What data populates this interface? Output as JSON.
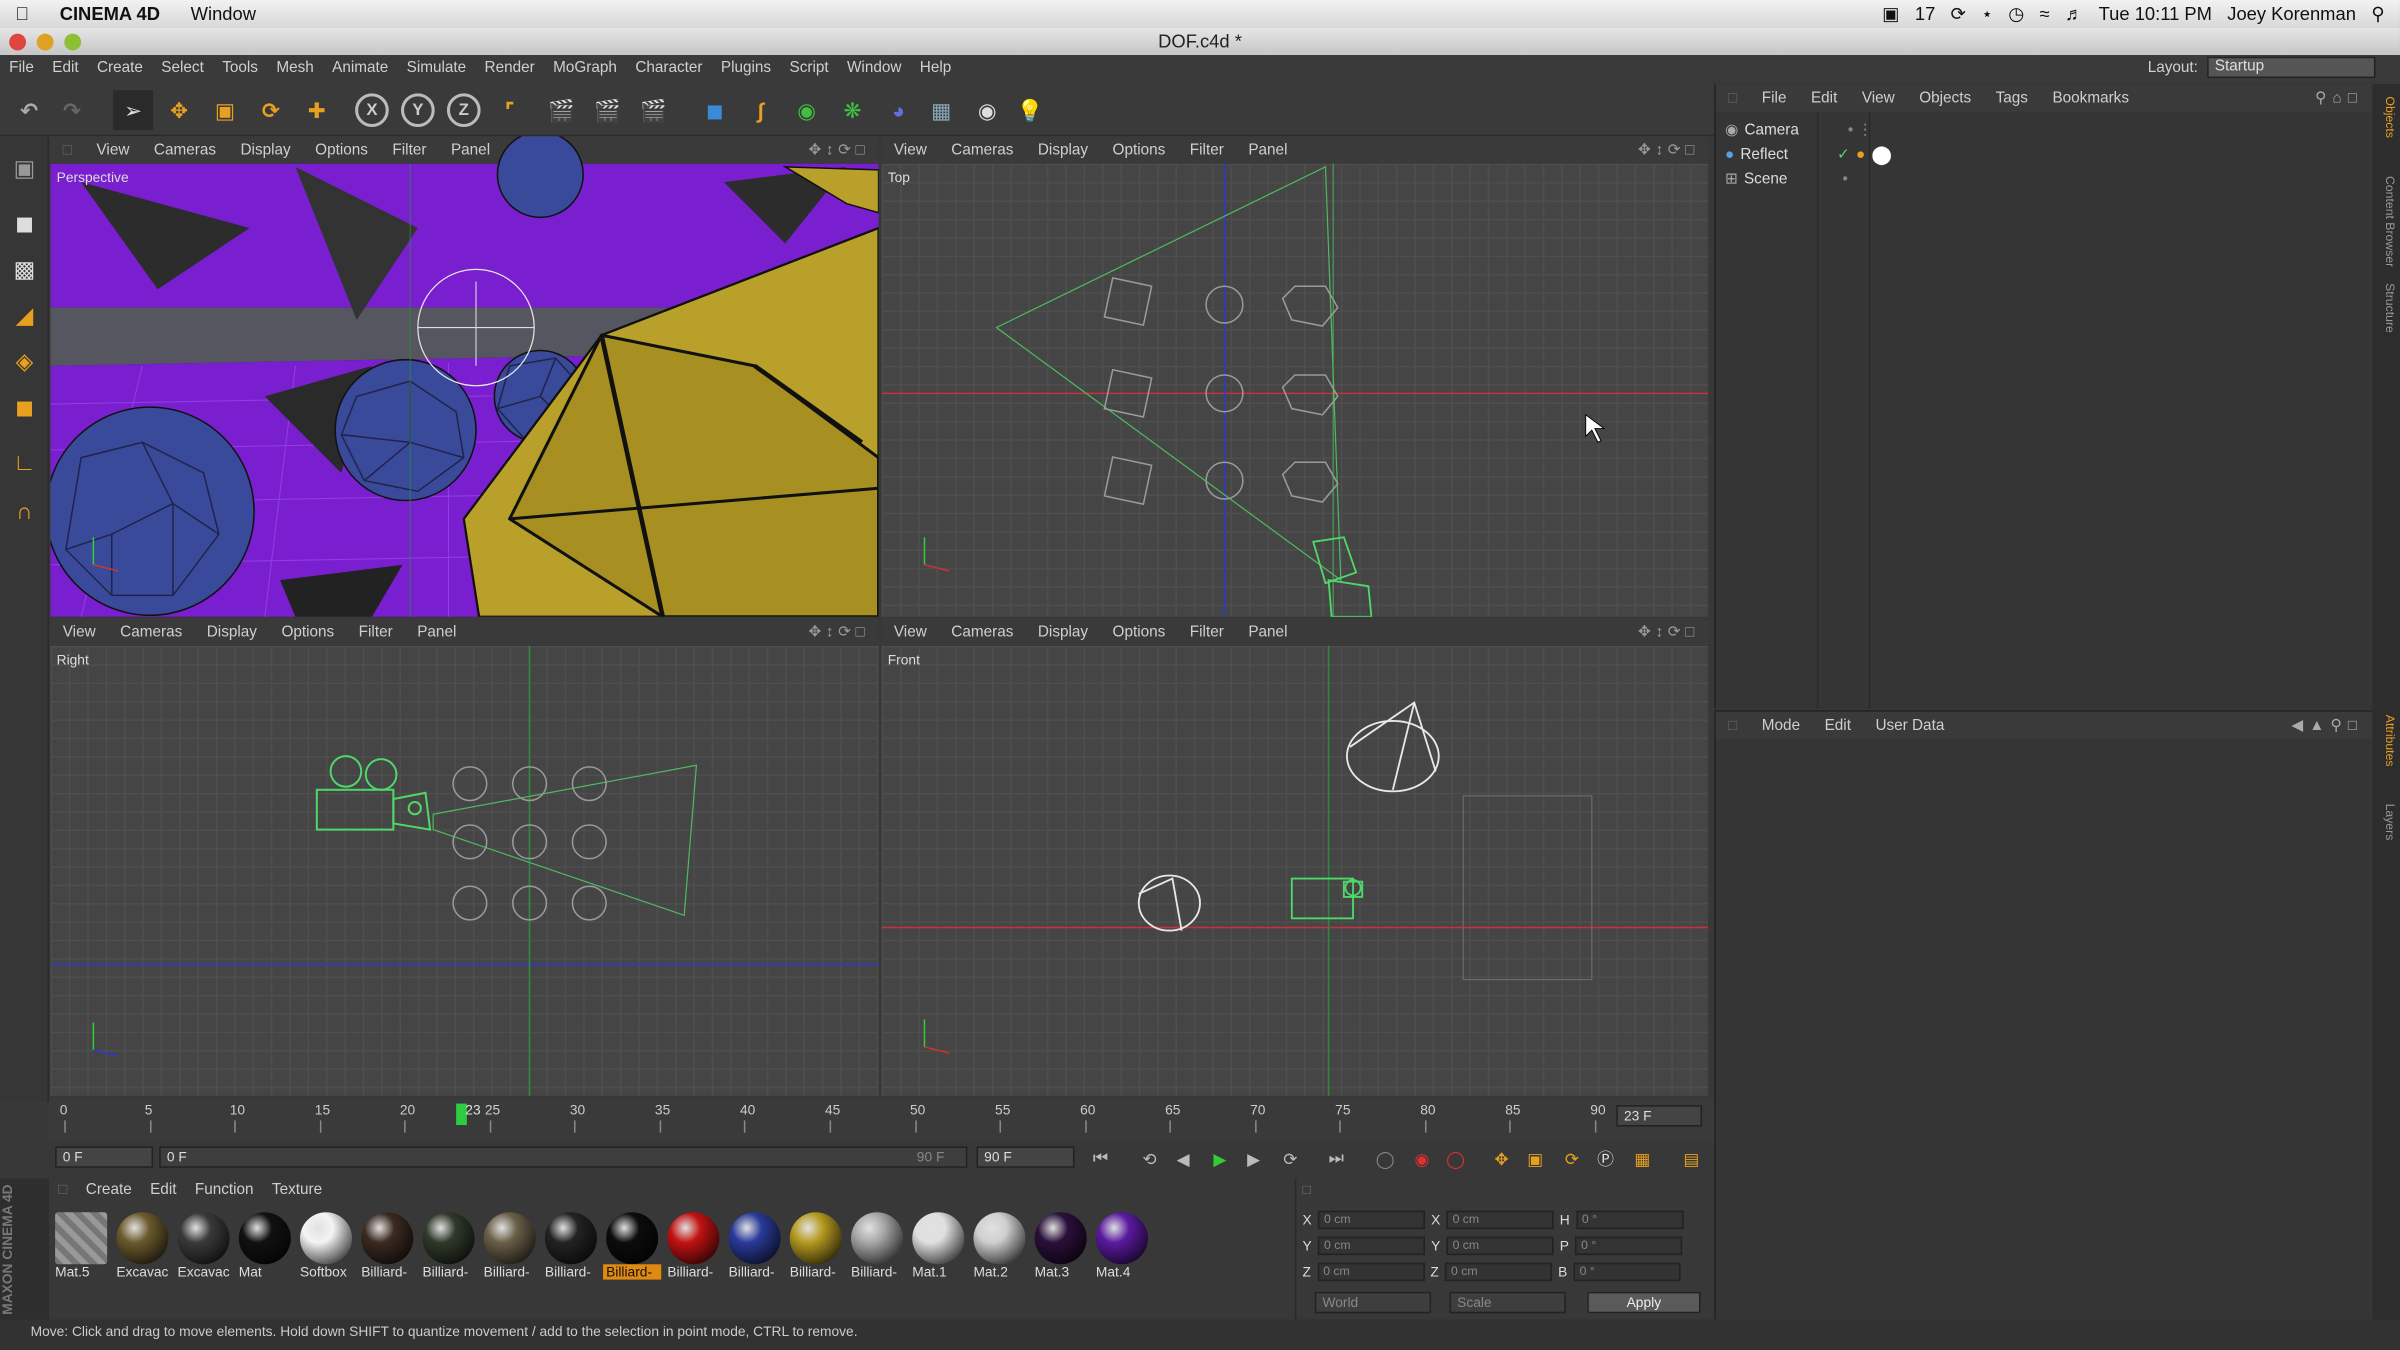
{
  "mac_menubar": {
    "app_name": "CINEMA 4D",
    "menu_window": "Window",
    "badge_count": "17",
    "clock": "Tue 10:11 PM",
    "user": "Joey Korenman"
  },
  "window": {
    "title": "DOF.c4d *"
  },
  "app_menu": {
    "items": [
      "File",
      "Edit",
      "Create",
      "Select",
      "Tools",
      "Mesh",
      "Animate",
      "Simulate",
      "Render",
      "MoGraph",
      "Character",
      "Plugins",
      "Script",
      "Window",
      "Help"
    ],
    "layout_label": "Layout:",
    "layout_value": "Startup"
  },
  "viewport_menu": [
    "View",
    "Cameras",
    "Display",
    "Options",
    "Filter",
    "Panel"
  ],
  "viewports": {
    "perspective": "Perspective",
    "top": "Top",
    "right": "Right",
    "front": "Front"
  },
  "object_manager": {
    "menu": [
      "File",
      "Edit",
      "View",
      "Objects",
      "Tags",
      "Bookmarks"
    ],
    "objects": [
      "Camera",
      "Reflect",
      "Scene"
    ]
  },
  "attribute_manager": {
    "menu": [
      "Mode",
      "Edit",
      "User Data"
    ]
  },
  "side_tabs": [
    "Objects",
    "Content Browser",
    "Structure",
    "Attributes",
    "Layers"
  ],
  "timeline": {
    "ticks": [
      "0",
      "5",
      "10",
      "15",
      "20",
      "25",
      "30",
      "35",
      "40",
      "45",
      "50",
      "55",
      "60",
      "65",
      "70",
      "75",
      "80",
      "85",
      "90"
    ],
    "playhead_label": "23",
    "current_frame_display": "23 F",
    "start_field": "0 F",
    "range_start": "0 F",
    "range_end": "90 F",
    "end_field": "90 F",
    "playhead_fraction": 0.2556
  },
  "material_manager": {
    "menu": [
      "Create",
      "Edit",
      "Function",
      "Texture"
    ],
    "materials": [
      {
        "label": "Mat.5",
        "color": "#888888",
        "kind": "stripe"
      },
      {
        "label": "Excavac",
        "color": "#6b5a2c",
        "kind": "ball"
      },
      {
        "label": "Excavac",
        "color": "#3a3a3a",
        "kind": "ball"
      },
      {
        "label": "Mat",
        "color": "#111111",
        "kind": "ball"
      },
      {
        "label": "Softbox",
        "color": "#f4f4f4",
        "kind": "ball"
      },
      {
        "label": "Billiard-",
        "color": "#3b2a22",
        "kind": "ball"
      },
      {
        "label": "Billiard-",
        "color": "#2f3a2a",
        "kind": "ball"
      },
      {
        "label": "Billiard-",
        "color": "#6a6048",
        "kind": "ball"
      },
      {
        "label": "Billiard-",
        "color": "#232323",
        "kind": "ball"
      },
      {
        "label": "Billiard-",
        "color": "#0c0c0c",
        "kind": "ball",
        "selected": true
      },
      {
        "label": "Billiard-",
        "color": "#c21212",
        "kind": "ball"
      },
      {
        "label": "Billiard-",
        "color": "#2a3a9a",
        "kind": "ball"
      },
      {
        "label": "Billiard-",
        "color": "#b69a20",
        "kind": "ball"
      },
      {
        "label": "Billiard-",
        "color": "#a8a8a8",
        "kind": "ball"
      },
      {
        "label": "Mat.1",
        "color": "#e0e0e0",
        "kind": "ball"
      },
      {
        "label": "Mat.2",
        "color": "#cfcfcf",
        "kind": "ball"
      },
      {
        "label": "Mat.3",
        "color": "#2a0f3a",
        "kind": "ball"
      },
      {
        "label": "Mat.4",
        "color": "#5a1aa0",
        "kind": "ball"
      }
    ]
  },
  "coordinates": {
    "rows": [
      {
        "a": "X",
        "av": "0 cm",
        "b": "X",
        "bv": "0 cm",
        "c": "H",
        "cv": "0 °"
      },
      {
        "a": "Y",
        "av": "0 cm",
        "b": "Y",
        "bv": "0 cm",
        "c": "P",
        "cv": "0 °"
      },
      {
        "a": "Z",
        "av": "0 cm",
        "b": "Z",
        "bv": "0 cm",
        "c": "B",
        "cv": "0 °"
      }
    ],
    "mode_world": "World",
    "mode_scale": "Scale",
    "apply_label": "Apply"
  },
  "status_bar": "Move: Click and drag to move elements. Hold down SHIFT to quantize movement / add to the selection in point mode, CTRL to remove.",
  "brand_vertical": "MAXON CINEMA 4D",
  "colors": {
    "purple_floor": "#7a1fd0",
    "yellow_mesh": "#b8a02a",
    "blue_sphere": "#3a4a9a",
    "green_wire": "#4fd86a",
    "axis_red": "#c8303a",
    "axis_blue": "#2a3ad0",
    "axis_green": "#2c8a3c",
    "accent_orange": "#e08a10"
  }
}
